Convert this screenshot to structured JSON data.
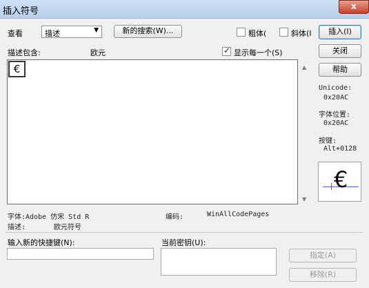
{
  "window": {
    "title": "插入符号",
    "close_label": "x"
  },
  "toolbar": {
    "view_label": "查看",
    "view_select": "描述",
    "new_search_button": "新的搜索(W)...",
    "bold_label": "粗体(",
    "italic_label": "斜体(I",
    "insert_button": "插入(I)"
  },
  "buttons": {
    "close": "关闭",
    "help": "帮助",
    "assign": "指定(A)",
    "remove": "移除(R)"
  },
  "search": {
    "desc_contains_label": "描述包含:",
    "desc_contains_value": "欧元",
    "show_each_label": "显示每一个(S)",
    "show_each_checked": true
  },
  "grid": {
    "selected_char": "€"
  },
  "info": {
    "unicode_label": "Unicode:",
    "unicode_value": "0x20AC",
    "font_pos_label": "字体位置:",
    "font_pos_value": "0x20AC",
    "keystroke_label": "按键:",
    "keystroke_value": "Alt+0128",
    "preview_char": "€"
  },
  "status": {
    "font_line": "字体:Adobe 仿宋 Std R",
    "encoding_label": "编码:",
    "encoding_value": "WinAllCodePages",
    "description_label": "描述:",
    "description_value": "欧元符号"
  },
  "shortcut": {
    "new_key_label": "输入新的快捷键(N):",
    "current_keys_label": "当前密钥(U):"
  },
  "colors": {
    "title_bar": "#b8cfea",
    "close_button": "#c8402c",
    "default_button_border": "#3c7fb1"
  }
}
